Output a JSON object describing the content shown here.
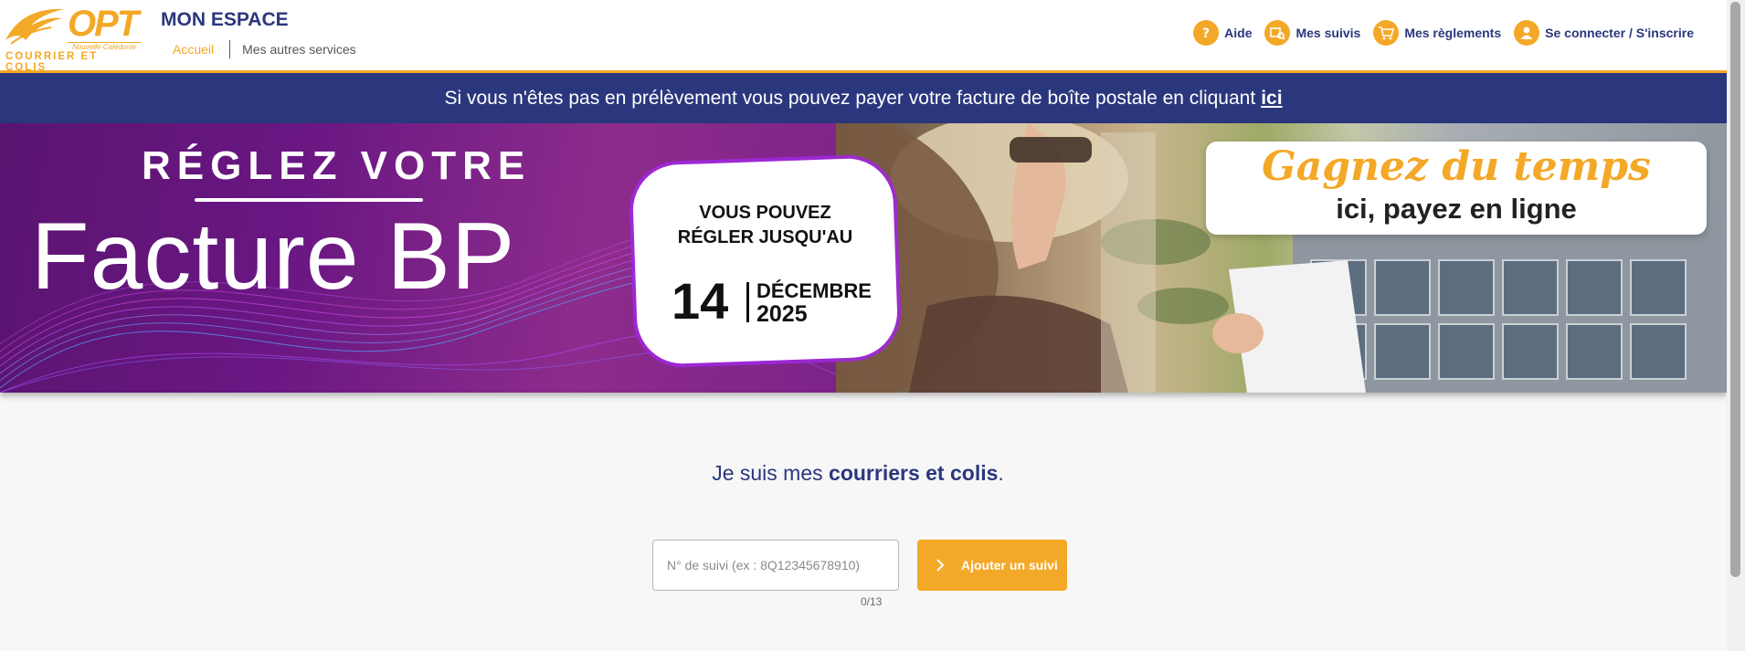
{
  "header": {
    "logo": {
      "main": "OPT",
      "sub": "Nouvelle-Calédonie",
      "bottom": "COURRIER ET COLIS"
    },
    "brand_title": "MON ESPACE",
    "nav": [
      {
        "label": "Accueil",
        "active": true
      },
      {
        "label": "Mes autres services",
        "active": false
      }
    ],
    "actions": [
      {
        "label": "Aide",
        "icon": "help-icon"
      },
      {
        "label": "Mes suivis",
        "icon": "tracking-icon"
      },
      {
        "label": "Mes règlements",
        "icon": "cart-icon"
      },
      {
        "label": "Se connecter / S'inscrire",
        "icon": "user-icon"
      }
    ]
  },
  "info_banner": {
    "text": "Si vous n'êtes pas en prélèvement vous pouvez payer votre facture de boîte postale en cliquant",
    "link": "ici"
  },
  "hero": {
    "title_top": "RÉGLEZ VOTRE",
    "title_main": "Facture BP",
    "date_card": {
      "line1": "VOUS POUVEZ",
      "line2": "RÉGLER JUSQU'AU",
      "day": "14",
      "month": "DÉCEMBRE",
      "year": "2025"
    },
    "promo": {
      "line1": "Gagnez du temps",
      "line2": "ici, payez en ligne"
    }
  },
  "main": {
    "headline_prefix": "Je suis mes ",
    "headline_bold": "courriers et colis",
    "headline_suffix": ".",
    "tracking": {
      "placeholder": "N° de suivi (ex : 8Q12345678910)",
      "value": "",
      "counter": "0/13",
      "button_label": "Ajouter un suivi"
    }
  },
  "colors": {
    "accent": "#f4a827",
    "primary": "#2b377d",
    "hero_purple": "#6a1783",
    "background": "#f7f7f7"
  }
}
